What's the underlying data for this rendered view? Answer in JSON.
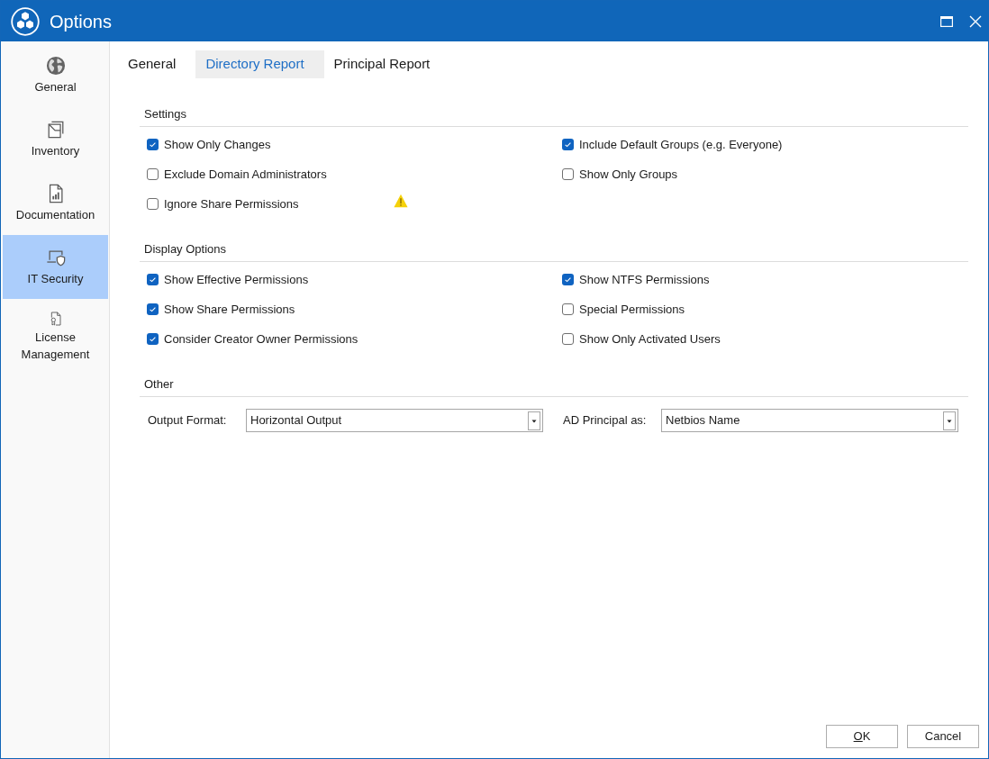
{
  "window": {
    "title": "Options"
  },
  "sidebar": {
    "items": [
      {
        "label": "General",
        "selected": false
      },
      {
        "label": "Inventory",
        "selected": false
      },
      {
        "label": "Documentation",
        "selected": false
      },
      {
        "label": "IT Security",
        "selected": true
      },
      {
        "label": "License Management",
        "selected": false
      }
    ]
  },
  "tabs": [
    {
      "label": "General",
      "selected": false
    },
    {
      "label": "Directory Report",
      "selected": true
    },
    {
      "label": "Principal Report",
      "selected": false
    }
  ],
  "sections": [
    {
      "kind": "checkboxes",
      "title": "Settings",
      "left": [
        {
          "label": "Show Only Changes",
          "checked": true,
          "warning": false
        },
        {
          "label": "Exclude Domain Administrators",
          "checked": false,
          "warning": false
        },
        {
          "label": "Ignore Share Permissions",
          "checked": false,
          "warning": true
        }
      ],
      "right": [
        {
          "label": "Include Default Groups (e.g. Everyone)",
          "checked": true,
          "warning": false
        },
        {
          "label": "Show Only Groups",
          "checked": false,
          "warning": false
        }
      ]
    },
    {
      "kind": "checkboxes",
      "title": "Display Options",
      "left": [
        {
          "label": "Show Effective Permissions",
          "checked": true,
          "warning": false
        },
        {
          "label": "Show Share Permissions",
          "checked": true,
          "warning": false
        },
        {
          "label": "Consider Creator Owner Permissions",
          "checked": true,
          "warning": false
        }
      ],
      "right": [
        {
          "label": "Show NTFS Permissions",
          "checked": true,
          "warning": false
        },
        {
          "label": "Special Permissions",
          "checked": false,
          "warning": false
        },
        {
          "label": "Show Only Activated Users",
          "checked": false,
          "warning": false
        }
      ]
    },
    {
      "kind": "fields",
      "title": "Other",
      "fields": [
        {
          "label": "Output Format:",
          "value": "Horizontal Output"
        },
        {
          "label": "AD Principal as:",
          "value": "Netbios Name"
        }
      ]
    }
  ],
  "buttons": [
    {
      "label": "OK",
      "mnemonic": true
    },
    {
      "label": "Cancel",
      "mnemonic": false
    }
  ]
}
